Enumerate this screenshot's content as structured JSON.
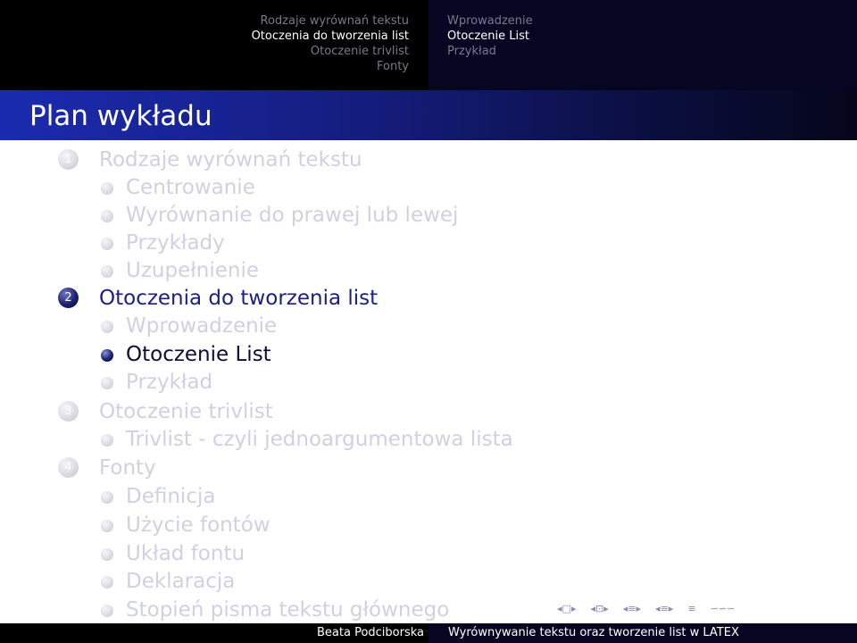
{
  "header": {
    "sections": [
      "Rodzaje wyrównań tekstu",
      "Otoczenia do tworzenia list",
      "Otoczenie trivlist",
      "Fonty"
    ],
    "subsections": [
      "Wprowadzenie",
      "Otoczenie List",
      "Przykład"
    ]
  },
  "frame_title": "Plan wykładu",
  "outline": {
    "sections": [
      {
        "number": "1",
        "title": "Rodzaje wyrównań tekstu",
        "subsections": [
          "Centrowanie",
          "Wyrównanie do prawej lub lewej",
          "Przykłady",
          "Uzupełnienie"
        ]
      },
      {
        "number": "2",
        "title": "Otoczenia do tworzenia list",
        "subsections": [
          "Wprowadzenie",
          "Otoczenie List",
          "Przykład"
        ]
      },
      {
        "number": "3",
        "title": "Otoczenie trivlist",
        "subsections": [
          "Trivlist - czyli jednoargumentowa lista"
        ]
      },
      {
        "number": "4",
        "title": "Fonty",
        "subsections": [
          "Definicja",
          "Użycie fontów",
          "Układ fontu",
          "Deklaracja",
          "Stopień pisma tekstu głównego"
        ]
      }
    ]
  },
  "footer": {
    "author": "Beata Podciborska",
    "title": "Wyrównywanie tekstu oraz tworzenie list w LATEX"
  },
  "nav_symbols": {
    "slide_prev": "◂",
    "slide": "□",
    "slide_next": "▸",
    "frame_prev": "◂",
    "frame": "⊡",
    "frame_next": "▸",
    "subsection_prev": "◂",
    "subsection": "≡",
    "subsection_next": "▸",
    "section_prev": "◂",
    "section": "≡",
    "section_next": "▸",
    "align": "≡",
    "search": "∽∽∽"
  },
  "colors": {
    "title_bar_start": "#1b2bb0",
    "title_bar_end": "#05061a",
    "current_section": "#1c2180",
    "current_subsection": "#0c0c34",
    "dimmed": "#d0d0e2"
  }
}
